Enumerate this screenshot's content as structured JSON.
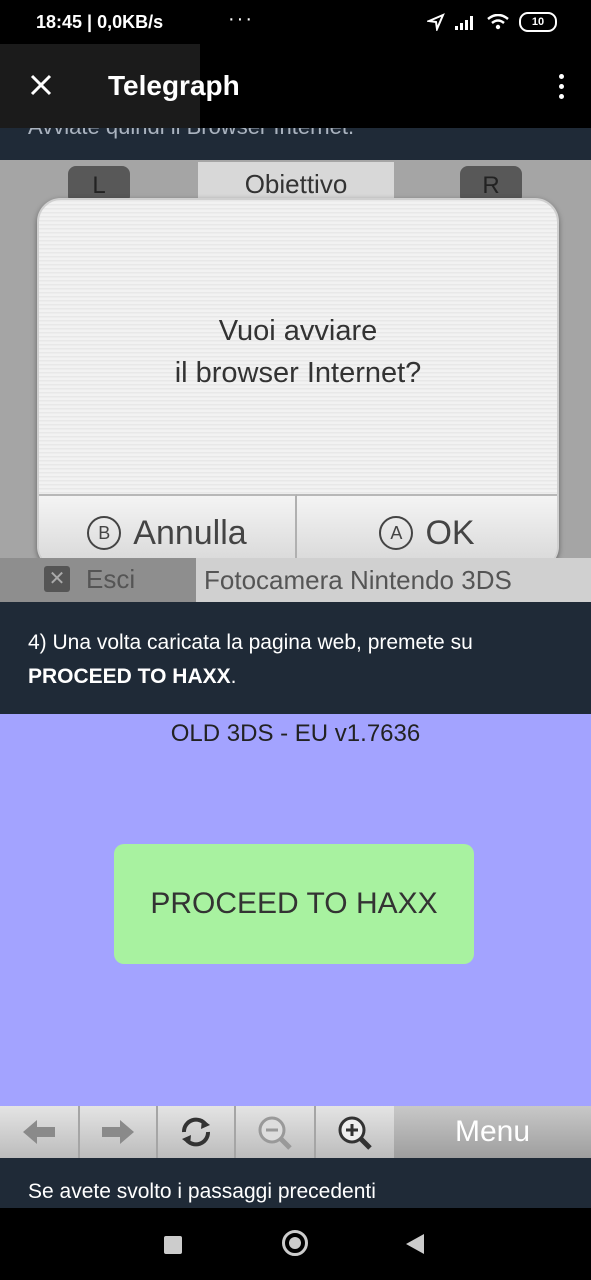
{
  "status_bar": {
    "time_speed": "18:45 | 0,0KB/s",
    "more": "···",
    "battery": "10"
  },
  "toolbar": {
    "title": "Telegraph"
  },
  "article": {
    "cut_text": "Avviate quindi il Browser Internet.",
    "screenshot1": {
      "tab_label": "Obiettivo",
      "l_button": "L",
      "r_button": "R",
      "dialog_line1": "Vuoi avviare",
      "dialog_line2": "il browser Internet?",
      "cancel_letter": "B",
      "cancel_label": "Annulla",
      "ok_letter": "A",
      "ok_label": "OK",
      "exit_label": "Esci",
      "camera_label": "Fotocamera Nintendo 3DS"
    },
    "paragraph_prefix": "4) Una volta caricata la pagina web, premete su",
    "paragraph_bold": "PROCEED TO HAXX",
    "paragraph_suffix": ".",
    "screenshot2": {
      "version": "OLD 3DS - EU v1.7636",
      "proceed_button": "PROCEED TO HAXX",
      "menu": "Menu"
    },
    "next_paragraph": "Se avete svolto i passaggi precedenti"
  }
}
